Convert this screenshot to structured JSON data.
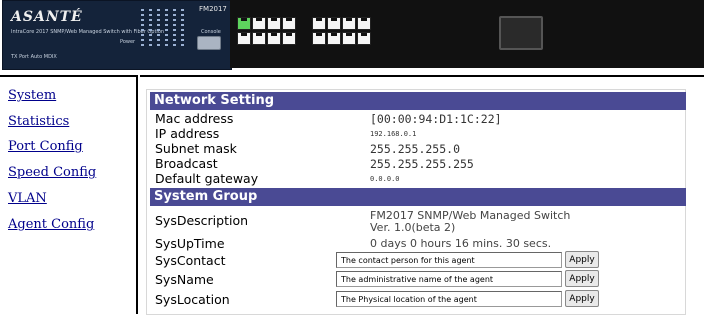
{
  "banner": {
    "logo": "ASANTÉ",
    "subtitle": "IntraCore 2017 SNMP/Web Managed Switch with Fiber Option",
    "tp_label": "TX Port Auto MDIX",
    "model": "FM2017",
    "console_label": "Console",
    "power_label": "Power"
  },
  "sidebar": {
    "items": [
      {
        "label": "System"
      },
      {
        "label": "Statistics"
      },
      {
        "label": "Port Config"
      },
      {
        "label": "Speed Config"
      },
      {
        "label": "VLAN"
      },
      {
        "label": "Agent Config"
      }
    ]
  },
  "network": {
    "title": "Network Setting",
    "mac_label": "Mac address",
    "mac_value": "[00:00:94:D1:1C:22]",
    "ip_label": "IP address",
    "ip_value": "192.168.0.1",
    "mask_label": "Subnet mask",
    "mask_value": "255.255.255.0",
    "bcast_label": "Broadcast",
    "bcast_value": "255.255.255.255",
    "gw_label": "Default gateway",
    "gw_value": "0.0.0.0"
  },
  "system": {
    "title": "System Group",
    "desc_label": "SysDescription",
    "desc_line1": "FM2017 SNMP/Web Managed Switch",
    "desc_line2": "Ver. 1.0(beta 2)",
    "uptime_label": "SysUpTime",
    "uptime_value": "0 days 0 hours 16 mins. 30 secs.",
    "contact_label": "SysContact",
    "contact_value": "The contact person for this agent",
    "name_label": "SysName",
    "name_value": "The administrative name of the agent",
    "location_label": "SysLocation",
    "location_value": "The Physical location of the agent",
    "apply_label": "Apply"
  },
  "colors": {
    "section_bar": "#4a4a94",
    "link": "#00008b",
    "device_body": "#14233a",
    "port_active": "#5ed45e"
  }
}
